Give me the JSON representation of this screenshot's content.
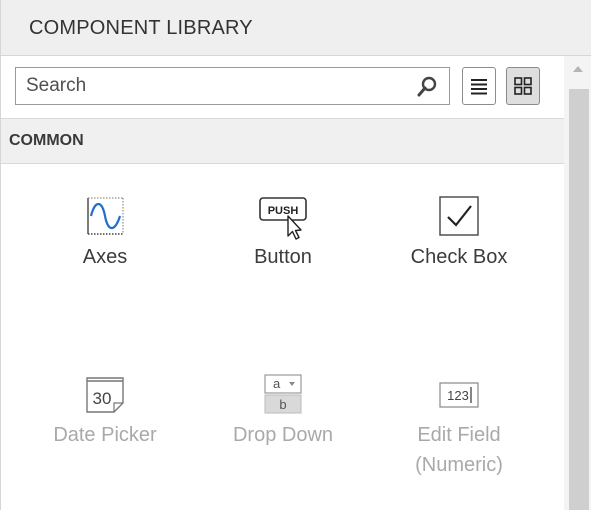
{
  "header": {
    "title": "COMPONENT LIBRARY"
  },
  "search": {
    "placeholder": "Search",
    "value": ""
  },
  "view_buttons": {
    "list": "list-view",
    "grid": "grid-view"
  },
  "category": {
    "title": "COMMON"
  },
  "components": [
    {
      "label": "Axes",
      "icon": "axes-icon",
      "enabled": true
    },
    {
      "label": "Button",
      "icon": "push-button-icon",
      "icon_text": "PUSH",
      "enabled": true
    },
    {
      "label": "Check Box",
      "icon": "checkbox-icon",
      "enabled": true
    },
    {
      "label": "Date Picker",
      "icon": "date-picker-icon",
      "icon_text": "30",
      "enabled": false
    },
    {
      "label": "Drop Down",
      "icon": "drop-down-icon",
      "icon_text_top": "a",
      "icon_text_bottom": "b",
      "enabled": false
    },
    {
      "label": "Edit Field",
      "label_line2": "(Numeric)",
      "icon": "edit-field-numeric-icon",
      "icon_text": "123",
      "enabled": false
    }
  ],
  "colors": {
    "header_bg": "#efefef",
    "category_bg": "#f0f0f0",
    "disabled_text": "#a9a9a9",
    "axes_blue": "#1f6fd1"
  }
}
